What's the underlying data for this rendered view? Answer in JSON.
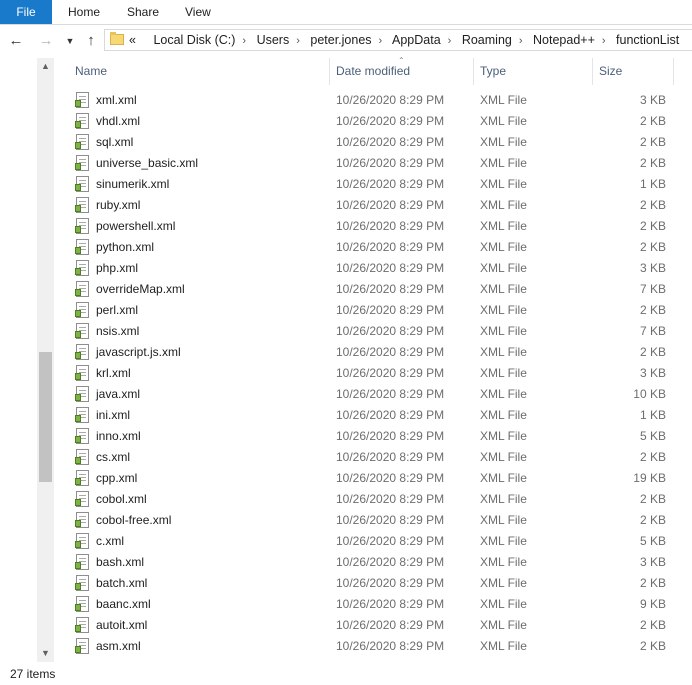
{
  "ribbon": {
    "file": "File",
    "tabs": [
      "Home",
      "Share",
      "View"
    ]
  },
  "nav": {
    "back_icon": "arrow-left-icon",
    "forward_icon": "arrow-right-icon",
    "recent_icon": "chevron-down-icon",
    "up_icon": "arrow-up-icon"
  },
  "address": {
    "overflow": "«",
    "crumbs": [
      "Local Disk (C:)",
      "Users",
      "peter.jones",
      "AppData",
      "Roaming",
      "Notepad++",
      "functionList"
    ]
  },
  "columns": {
    "name": "Name",
    "date": "Date modified",
    "type": "Type",
    "size": "Size"
  },
  "files": [
    {
      "name": "xml.xml",
      "date": "10/26/2020 8:29 PM",
      "type": "XML File",
      "size": "3 KB"
    },
    {
      "name": "vhdl.xml",
      "date": "10/26/2020 8:29 PM",
      "type": "XML File",
      "size": "2 KB"
    },
    {
      "name": "sql.xml",
      "date": "10/26/2020 8:29 PM",
      "type": "XML File",
      "size": "2 KB"
    },
    {
      "name": "universe_basic.xml",
      "date": "10/26/2020 8:29 PM",
      "type": "XML File",
      "size": "2 KB"
    },
    {
      "name": "sinumerik.xml",
      "date": "10/26/2020 8:29 PM",
      "type": "XML File",
      "size": "1 KB"
    },
    {
      "name": "ruby.xml",
      "date": "10/26/2020 8:29 PM",
      "type": "XML File",
      "size": "2 KB"
    },
    {
      "name": "powershell.xml",
      "date": "10/26/2020 8:29 PM",
      "type": "XML File",
      "size": "2 KB"
    },
    {
      "name": "python.xml",
      "date": "10/26/2020 8:29 PM",
      "type": "XML File",
      "size": "2 KB"
    },
    {
      "name": "php.xml",
      "date": "10/26/2020 8:29 PM",
      "type": "XML File",
      "size": "3 KB"
    },
    {
      "name": "overrideMap.xml",
      "date": "10/26/2020 8:29 PM",
      "type": "XML File",
      "size": "7 KB"
    },
    {
      "name": "perl.xml",
      "date": "10/26/2020 8:29 PM",
      "type": "XML File",
      "size": "2 KB"
    },
    {
      "name": "nsis.xml",
      "date": "10/26/2020 8:29 PM",
      "type": "XML File",
      "size": "7 KB"
    },
    {
      "name": "javascript.js.xml",
      "date": "10/26/2020 8:29 PM",
      "type": "XML File",
      "size": "2 KB"
    },
    {
      "name": "krl.xml",
      "date": "10/26/2020 8:29 PM",
      "type": "XML File",
      "size": "3 KB"
    },
    {
      "name": "java.xml",
      "date": "10/26/2020 8:29 PM",
      "type": "XML File",
      "size": "10 KB"
    },
    {
      "name": "ini.xml",
      "date": "10/26/2020 8:29 PM",
      "type": "XML File",
      "size": "1 KB"
    },
    {
      "name": "inno.xml",
      "date": "10/26/2020 8:29 PM",
      "type": "XML File",
      "size": "5 KB"
    },
    {
      "name": "cs.xml",
      "date": "10/26/2020 8:29 PM",
      "type": "XML File",
      "size": "2 KB"
    },
    {
      "name": "cpp.xml",
      "date": "10/26/2020 8:29 PM",
      "type": "XML File",
      "size": "19 KB"
    },
    {
      "name": "cobol.xml",
      "date": "10/26/2020 8:29 PM",
      "type": "XML File",
      "size": "2 KB"
    },
    {
      "name": "cobol-free.xml",
      "date": "10/26/2020 8:29 PM",
      "type": "XML File",
      "size": "2 KB"
    },
    {
      "name": "c.xml",
      "date": "10/26/2020 8:29 PM",
      "type": "XML File",
      "size": "5 KB"
    },
    {
      "name": "bash.xml",
      "date": "10/26/2020 8:29 PM",
      "type": "XML File",
      "size": "3 KB"
    },
    {
      "name": "batch.xml",
      "date": "10/26/2020 8:29 PM",
      "type": "XML File",
      "size": "2 KB"
    },
    {
      "name": "baanc.xml",
      "date": "10/26/2020 8:29 PM",
      "type": "XML File",
      "size": "9 KB"
    },
    {
      "name": "autoit.xml",
      "date": "10/26/2020 8:29 PM",
      "type": "XML File",
      "size": "2 KB"
    },
    {
      "name": "asm.xml",
      "date": "10/26/2020 8:29 PM",
      "type": "XML File",
      "size": "2 KB"
    }
  ],
  "status": {
    "count": "27 items"
  },
  "colors": {
    "file_tab": "#1979ca",
    "header_text": "#4c607a",
    "meta_text": "#6d6d6d"
  }
}
